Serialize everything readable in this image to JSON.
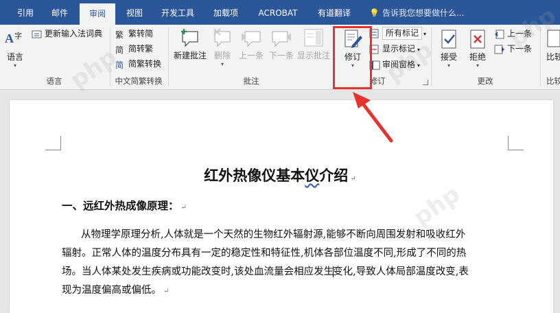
{
  "tabs": [
    "引用",
    "邮件",
    "审阅",
    "视图",
    "开发工具",
    "加载项",
    "ACROBAT",
    "有道翻译"
  ],
  "active_tab": "审阅",
  "tell_me": "告诉我您想要做什么...",
  "ribbon": {
    "language": {
      "lang_btn": "语言",
      "update_ime": "更新输入法词典",
      "group": "语言"
    },
    "chinese": {
      "t2s": "繁转简",
      "s2t": "简转繁",
      "convert": "简繁转换",
      "group": "中文简繁转换"
    },
    "comments": {
      "new": "新建批注",
      "delete": "删除",
      "prev": "上一条",
      "next": "下一条",
      "show": "显示批注",
      "group": "批注"
    },
    "tracking": {
      "track": "修订",
      "all_markup": "所有标记",
      "show_markup": "显示标记",
      "review_pane": "审阅窗格",
      "group": "修订"
    },
    "changes": {
      "accept": "接受",
      "reject": "拒绝",
      "prev": "上一条",
      "next": "下一条",
      "group": "更改"
    },
    "compare": {
      "label": "比较",
      "group": "比较"
    }
  },
  "document": {
    "title": "红外热像仪基本介绍",
    "title_plain": "红外热像仪基本",
    "title_squiggle": "仪",
    "heading": "一、远红外热成像原理：",
    "para_lines": [
      "从物理学原理分析,人体就是一个天然的生物红外辐射源,能够不断向周围发射和吸收红外",
      "辐射。正常人体的温度分布具有一定的稳定性和特征性,机体各部位温度不同,形成了不同的热",
      "场。当人体某处发生疾病或功能改变时,该处血流量会相应发生",
      "变化,导致人体局部温度改变,表",
      "现为温度偏高或偏低。"
    ],
    "paragraph_mark": "↵"
  }
}
